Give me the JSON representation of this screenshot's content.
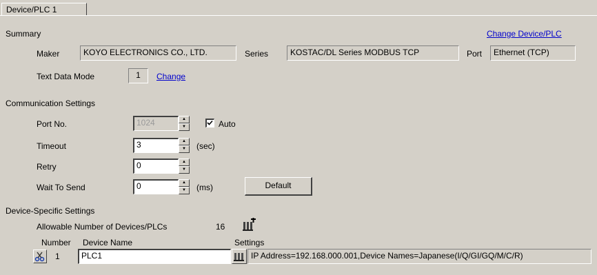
{
  "tab": {
    "label": "Device/PLC 1"
  },
  "summary": {
    "heading": "Summary",
    "change_link": "Change Device/PLC",
    "maker_label": "Maker",
    "maker_value": "KOYO ELECTRONICS CO., LTD.",
    "series_label": "Series",
    "series_value": "KOSTAC/DL Series MODBUS TCP",
    "port_label": "Port",
    "port_value": "Ethernet (TCP)",
    "text_mode_label": "Text Data Mode",
    "text_mode_value": "1",
    "text_mode_change": "Change"
  },
  "comm": {
    "heading": "Communication Settings",
    "port_no_label": "Port No.",
    "port_no_value": "1024",
    "auto_label": "Auto",
    "auto_checked": true,
    "timeout_label": "Timeout",
    "timeout_value": "3",
    "timeout_unit": "(sec)",
    "retry_label": "Retry",
    "retry_value": "0",
    "wait_label": "Wait To Send",
    "wait_value": "0",
    "wait_unit": "(ms)",
    "default_button": "Default"
  },
  "device": {
    "heading": "Device-Specific Settings",
    "allowable_label": "Allowable Number of Devices/PLCs",
    "allowable_value": "16",
    "col_number": "Number",
    "col_device_name": "Device Name",
    "col_settings": "Settings",
    "rows": [
      {
        "number": "1",
        "name": "PLC1",
        "settings": "IP Address=192.168.000.001,Device Names=Japanese(I/Q/GI/GQ/M/C/R)"
      }
    ]
  },
  "colors": {
    "background": "#d4d0c8",
    "link": "#0000cc",
    "field": "#ffffff"
  }
}
